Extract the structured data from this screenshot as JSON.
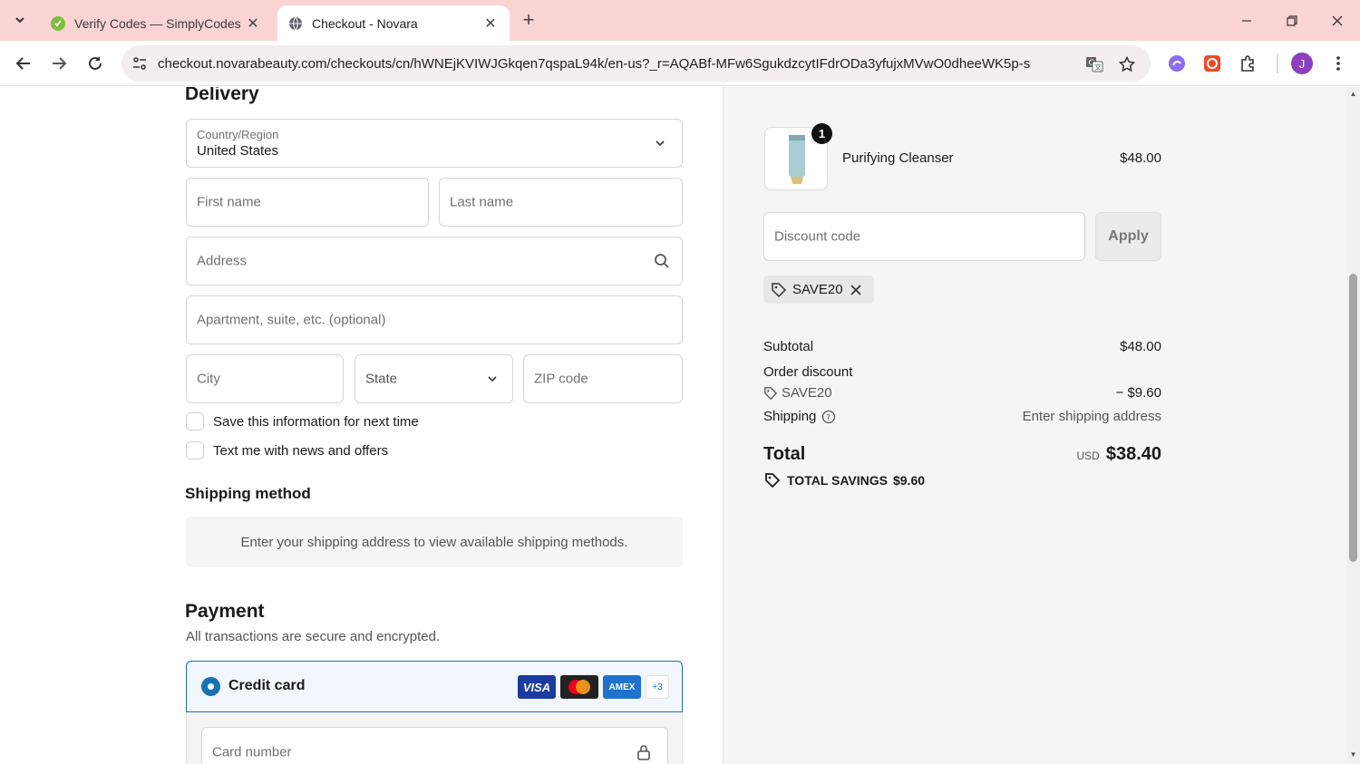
{
  "browser": {
    "tabs": [
      {
        "title": "Verify Codes — SimplyCodes",
        "icon": "simplycodes-favicon",
        "active": false
      },
      {
        "title": "Checkout - Novara",
        "icon": "globe-icon",
        "active": true
      }
    ],
    "url": "checkout.novarabeauty.com/checkouts/cn/hWNEjKVIWJGkqen7qspaL94k/en-us?_r=AQABf-MFw6SgukdzcytIFdrODa3yfujxMVwO0dheeWK5p-s",
    "profile_initial": "J"
  },
  "delivery": {
    "heading": "Delivery",
    "country_label": "Country/Region",
    "country_value": "United States",
    "first_name_placeholder": "First name",
    "last_name_placeholder": "Last name",
    "address_placeholder": "Address",
    "apartment_placeholder": "Apartment, suite, etc. (optional)",
    "city_placeholder": "City",
    "state_placeholder": "State",
    "zip_placeholder": "ZIP code",
    "save_info_label": "Save this information for next time",
    "text_me_label": "Text me with news and offers"
  },
  "shipping_method": {
    "heading": "Shipping method",
    "info": "Enter your shipping address to view available shipping methods."
  },
  "payment": {
    "heading": "Payment",
    "subtitle": "All transactions are secure and encrypted.",
    "credit_card_label": "Credit card",
    "cards": [
      "VISA",
      "Mastercard",
      "AMEX"
    ],
    "more_cards": "+3",
    "card_number_placeholder": "Card number"
  },
  "summary": {
    "product_name": "Purifying Cleanser",
    "product_price": "$48.00",
    "quantity": "1",
    "discount_placeholder": "Discount code",
    "apply_label": "Apply",
    "applied_code": "SAVE20",
    "subtotal_label": "Subtotal",
    "subtotal_value": "$48.00",
    "order_discount_label": "Order discount",
    "discount_code": "SAVE20",
    "discount_value": "− $9.60",
    "shipping_label": "Shipping",
    "shipping_value": "Enter shipping address",
    "total_label": "Total",
    "currency": "USD",
    "total_value": "$38.40",
    "total_savings_label": "TOTAL SAVINGS",
    "total_savings_value": "$9.60"
  },
  "colors": {
    "tabbar": "#f9d4d3",
    "accent": "#1773b0",
    "summary_bg": "#f5f5f5"
  }
}
